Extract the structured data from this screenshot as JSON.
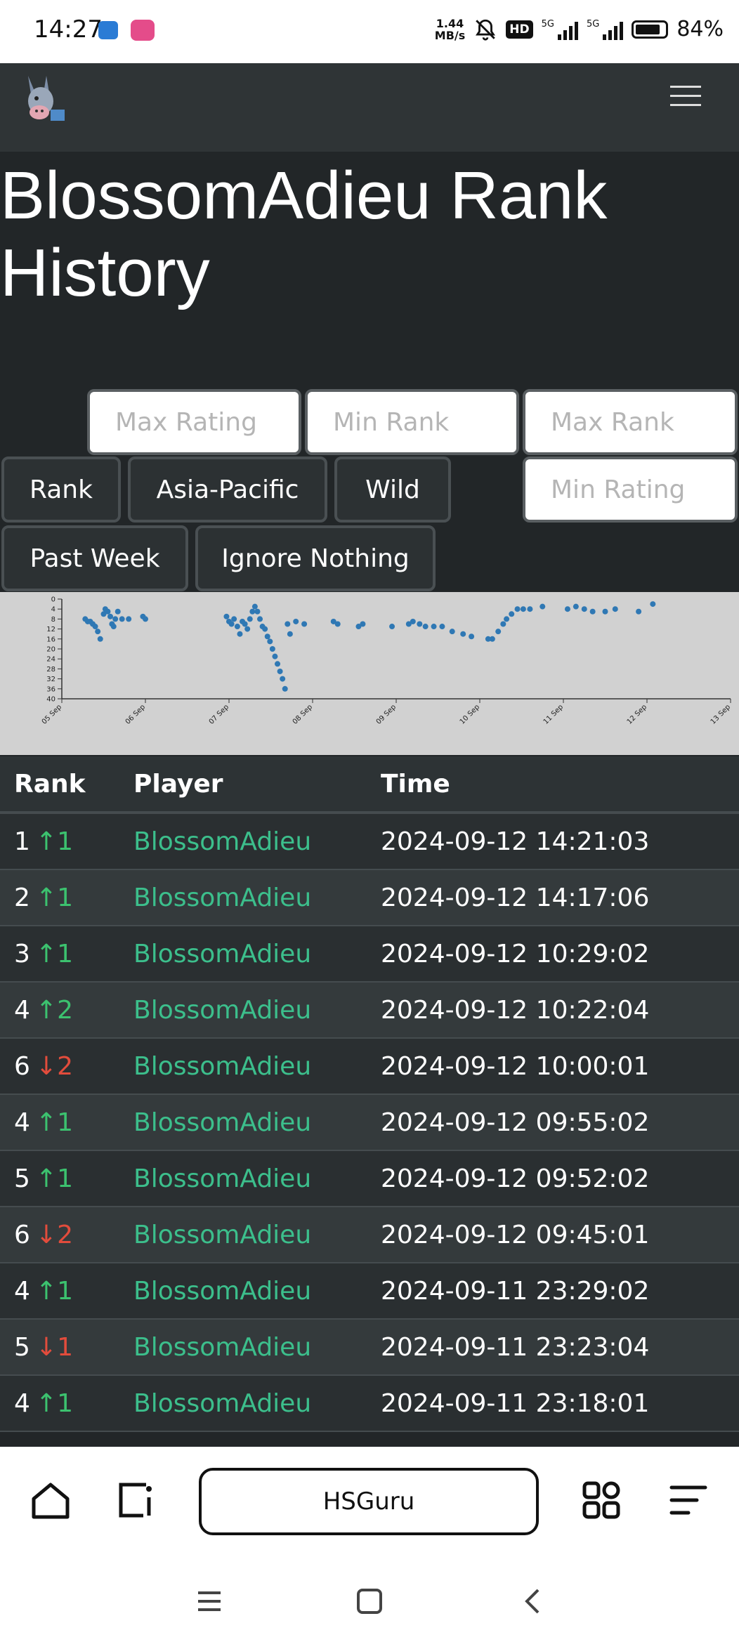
{
  "status_bar": {
    "time": "14:27",
    "speed_value": "1.44",
    "speed_unit": "MB/s",
    "hd": "HD",
    "net1": "5G",
    "net2": "5G",
    "battery": "84%"
  },
  "page": {
    "title": "BlossomAdieu Rank History"
  },
  "filters": {
    "max_rating_placeholder": "Max Rating",
    "min_rank_placeholder": "Min Rank",
    "max_rank_placeholder": "Max Rank",
    "min_rating_placeholder": "Min Rating",
    "buttons": {
      "rank": "Rank",
      "region": "Asia-Pacific",
      "format": "Wild",
      "period": "Past Week",
      "ignore": "Ignore Nothing"
    }
  },
  "chart_data": {
    "type": "scatter",
    "title": "",
    "xlabel": "",
    "ylabel": "",
    "x_ticks": [
      "05 Sep",
      "06 Sep",
      "07 Sep",
      "08 Sep",
      "09 Sep",
      "10 Sep",
      "11 Sep",
      "12 Sep",
      "13 Sep"
    ],
    "y_ticks": [
      0,
      4,
      8,
      12,
      16,
      20,
      24,
      28,
      32,
      36,
      40
    ],
    "ylim": [
      0,
      40
    ],
    "y_inverted": true,
    "grid": false,
    "point_color": "#2f78b4",
    "x_units": "days since 05 Sep",
    "points": [
      [
        0.28,
        8
      ],
      [
        0.31,
        9
      ],
      [
        0.34,
        9
      ],
      [
        0.37,
        10
      ],
      [
        0.4,
        11
      ],
      [
        0.43,
        13
      ],
      [
        0.46,
        16
      ],
      [
        0.5,
        6
      ],
      [
        0.52,
        4
      ],
      [
        0.55,
        5
      ],
      [
        0.58,
        7
      ],
      [
        0.6,
        10
      ],
      [
        0.62,
        11
      ],
      [
        0.64,
        8
      ],
      [
        0.67,
        5
      ],
      [
        0.72,
        8
      ],
      [
        0.8,
        8
      ],
      [
        0.97,
        7
      ],
      [
        1.0,
        8
      ],
      [
        1.97,
        7
      ],
      [
        2.0,
        9
      ],
      [
        2.03,
        10
      ],
      [
        2.06,
        8
      ],
      [
        2.1,
        11
      ],
      [
        2.13,
        14
      ],
      [
        2.16,
        9
      ],
      [
        2.19,
        10
      ],
      [
        2.22,
        12
      ],
      [
        2.25,
        8
      ],
      [
        2.28,
        5
      ],
      [
        2.31,
        3
      ],
      [
        2.34,
        5
      ],
      [
        2.37,
        8
      ],
      [
        2.4,
        11
      ],
      [
        2.43,
        12
      ],
      [
        2.46,
        15
      ],
      [
        2.49,
        17
      ],
      [
        2.52,
        20
      ],
      [
        2.55,
        23
      ],
      [
        2.58,
        26
      ],
      [
        2.61,
        29
      ],
      [
        2.64,
        32
      ],
      [
        2.67,
        36
      ],
      [
        2.7,
        10
      ],
      [
        2.73,
        14
      ],
      [
        2.8,
        9
      ],
      [
        2.9,
        10
      ],
      [
        3.25,
        9
      ],
      [
        3.3,
        10
      ],
      [
        3.55,
        11
      ],
      [
        3.6,
        10
      ],
      [
        3.95,
        11
      ],
      [
        4.15,
        10
      ],
      [
        4.2,
        9
      ],
      [
        4.28,
        10
      ],
      [
        4.35,
        11
      ],
      [
        4.45,
        11
      ],
      [
        4.55,
        11
      ],
      [
        4.67,
        13
      ],
      [
        4.8,
        14
      ],
      [
        4.9,
        15
      ],
      [
        5.1,
        16
      ],
      [
        5.15,
        16
      ],
      [
        5.22,
        13
      ],
      [
        5.28,
        10
      ],
      [
        5.32,
        8
      ],
      [
        5.38,
        6
      ],
      [
        5.45,
        4
      ],
      [
        5.52,
        4
      ],
      [
        5.6,
        4
      ],
      [
        5.75,
        3
      ],
      [
        6.05,
        4
      ],
      [
        6.15,
        3
      ],
      [
        6.25,
        4
      ],
      [
        6.35,
        5
      ],
      [
        6.5,
        5
      ],
      [
        6.62,
        4
      ],
      [
        6.9,
        5
      ],
      [
        7.07,
        2
      ]
    ]
  },
  "table": {
    "headers": {
      "rank": "Rank",
      "player": "Player",
      "time": "Time"
    },
    "rows": [
      {
        "rank": "1",
        "arrow": "↑",
        "dir": "up",
        "change": "1",
        "player": "BlossomAdieu",
        "time": "2024-09-12 14:21:03"
      },
      {
        "rank": "2",
        "arrow": "↑",
        "dir": "up",
        "change": "1",
        "player": "BlossomAdieu",
        "time": "2024-09-12 14:17:06"
      },
      {
        "rank": "3",
        "arrow": "↑",
        "dir": "up",
        "change": "1",
        "player": "BlossomAdieu",
        "time": "2024-09-12 10:29:02"
      },
      {
        "rank": "4",
        "arrow": "↑",
        "dir": "up",
        "change": "2",
        "player": "BlossomAdieu",
        "time": "2024-09-12 10:22:04"
      },
      {
        "rank": "6",
        "arrow": "↓",
        "dir": "down",
        "change": "2",
        "player": "BlossomAdieu",
        "time": "2024-09-12 10:00:01"
      },
      {
        "rank": "4",
        "arrow": "↑",
        "dir": "up",
        "change": "1",
        "player": "BlossomAdieu",
        "time": "2024-09-12 09:55:02"
      },
      {
        "rank": "5",
        "arrow": "↑",
        "dir": "up",
        "change": "1",
        "player": "BlossomAdieu",
        "time": "2024-09-12 09:52:02"
      },
      {
        "rank": "6",
        "arrow": "↓",
        "dir": "down",
        "change": "2",
        "player": "BlossomAdieu",
        "time": "2024-09-12 09:45:01"
      },
      {
        "rank": "4",
        "arrow": "↑",
        "dir": "up",
        "change": "1",
        "player": "BlossomAdieu",
        "time": "2024-09-11 23:29:02"
      },
      {
        "rank": "5",
        "arrow": "↓",
        "dir": "down",
        "change": "1",
        "player": "BlossomAdieu",
        "time": "2024-09-11 23:23:04"
      },
      {
        "rank": "4",
        "arrow": "↑",
        "dir": "up",
        "change": "1",
        "player": "BlossomAdieu",
        "time": "2024-09-11 23:18:01"
      }
    ]
  },
  "browser": {
    "address_text": "HSGuru"
  },
  "icons": {
    "logo": "donkey-logo-icon",
    "menu": "hamburger-menu-icon",
    "home": "home-icon",
    "tabs": "tabs-icon",
    "grid": "grid-apps-icon",
    "more": "menu-lines-icon",
    "sys_menu": "system-menu-icon",
    "sys_home": "system-home-icon",
    "sys_back": "system-back-icon"
  }
}
